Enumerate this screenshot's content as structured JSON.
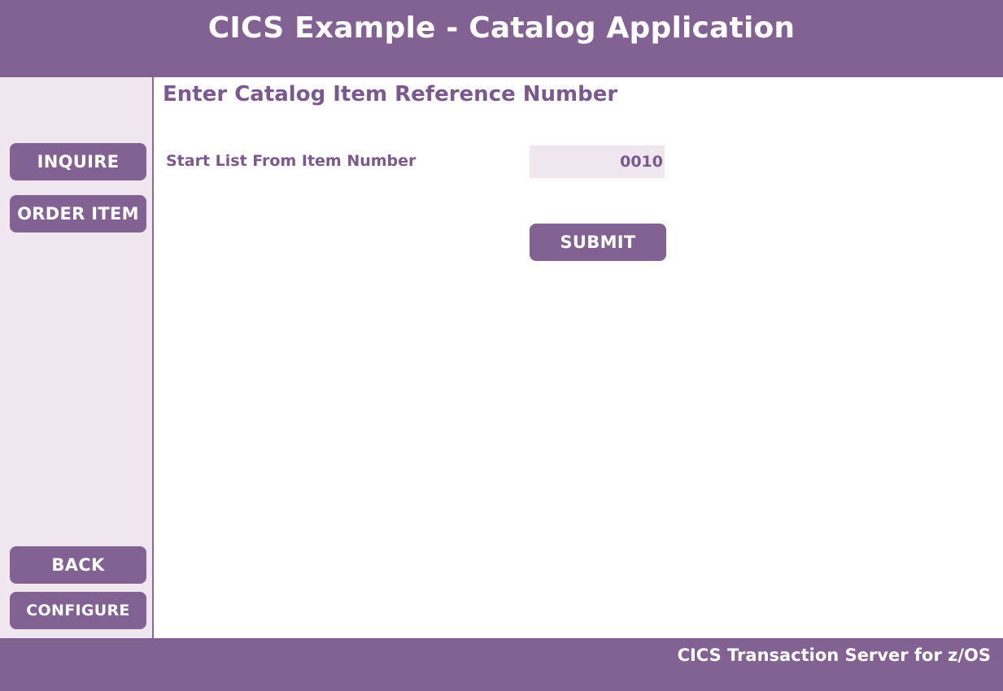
{
  "header": {
    "title": "CICS Example - Catalog Application"
  },
  "sidebar": {
    "buttons": [
      {
        "label": "INQUIRE"
      },
      {
        "label": "ORDER ITEM"
      },
      {
        "label": "BACK"
      },
      {
        "label": "CONFIGURE"
      }
    ]
  },
  "main": {
    "heading": "Enter Catalog Item Reference Number",
    "start_item": {
      "label": "Start List From Item Number",
      "value": "0010"
    },
    "submit_label": "SUBMIT"
  },
  "footer": {
    "text": "CICS Transaction Server for z/OS"
  },
  "colors": {
    "brand_purple": "#826193",
    "light_lilac": "#f0e6f0",
    "heading_purple": "#7a5a8e"
  }
}
